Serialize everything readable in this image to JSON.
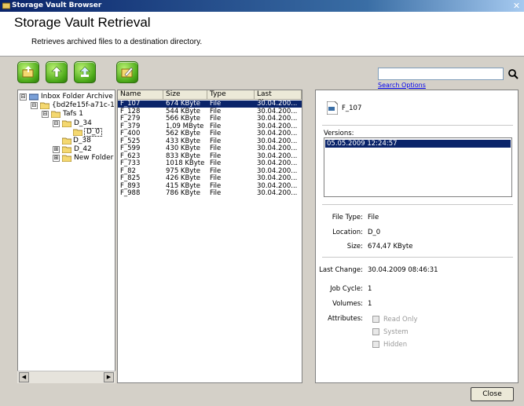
{
  "window": {
    "title": "Storage Vault Browser",
    "close_glyph": "✕"
  },
  "header": {
    "title": "Storage Vault Retrieval",
    "subtitle": "Retrieves archived files to a destination directory."
  },
  "toolbar": {
    "buttons": [
      "folder-restore-icon",
      "retrieve-icon",
      "retrieve-all-icon",
      "edit-icon"
    ],
    "accent": "#4aa818"
  },
  "search": {
    "value": "",
    "placeholder": "",
    "options_label": "Search Options"
  },
  "tree": {
    "nodes": [
      {
        "label": "Inbox Folder Archive",
        "expander": "⊟"
      },
      {
        "label": "{bd2fe15f-a71c-11d",
        "expander": "⊟"
      },
      {
        "label": "Tafs 1",
        "expander": "⊟"
      },
      {
        "label": "D_34",
        "expander": "⊟"
      },
      {
        "label": "D_0",
        "expander": ""
      },
      {
        "label": "D_38",
        "expander": ""
      },
      {
        "label": "D_42",
        "expander": "⊞"
      },
      {
        "label": "New Folder",
        "expander": "⊞"
      }
    ],
    "scroll_left": "◀",
    "scroll_right": "▶"
  },
  "filelist": {
    "columns": [
      "Name",
      "Size",
      "Type",
      "Last Change"
    ],
    "rows": [
      {
        "name": "F_107",
        "size": "674 KByte",
        "type": "File",
        "changed": "30.04.200..."
      },
      {
        "name": "F_128",
        "size": "544 KByte",
        "type": "File",
        "changed": "30.04.200..."
      },
      {
        "name": "F_279",
        "size": "566 KByte",
        "type": "File",
        "changed": "30.04.200..."
      },
      {
        "name": "F_379",
        "size": "1,09 MByte",
        "type": "File",
        "changed": "30.04.200..."
      },
      {
        "name": "F_400",
        "size": "562 KByte",
        "type": "File",
        "changed": "30.04.200..."
      },
      {
        "name": "F_525",
        "size": "433 KByte",
        "type": "File",
        "changed": "30.04.200..."
      },
      {
        "name": "F_599",
        "size": "430 KByte",
        "type": "File",
        "changed": "30.04.200..."
      },
      {
        "name": "F_623",
        "size": "833 KByte",
        "type": "File",
        "changed": "30.04.200..."
      },
      {
        "name": "F_733",
        "size": "1018 KByte",
        "type": "File",
        "changed": "30.04.200..."
      },
      {
        "name": "F_82",
        "size": "975 KByte",
        "type": "File",
        "changed": "30.04.200..."
      },
      {
        "name": "F_825",
        "size": "426 KByte",
        "type": "File",
        "changed": "30.04.200..."
      },
      {
        "name": "F_893",
        "size": "415 KByte",
        "type": "File",
        "changed": "30.04.200..."
      },
      {
        "name": "F_988",
        "size": "786 KByte",
        "type": "File",
        "changed": "30.04.200..."
      }
    ]
  },
  "details": {
    "file_name": "F_107",
    "versions_label": "Versions:",
    "versions": [
      "05.05.2009 12:24:57"
    ],
    "file_type_label": "File Type:",
    "file_type": "File",
    "location_label": "Location:",
    "location": "D_0",
    "size_label": "Size:",
    "size": "674,47 KByte",
    "last_change_label": "Last Change:",
    "last_change": "30.04.2009 08:46:31",
    "job_cycle_label": "Job Cycle:",
    "job_cycle": "1",
    "volumes_label": "Volumes:",
    "volumes": "1",
    "attributes_label": "Attributes:",
    "attributes": [
      "Read Only",
      "System",
      "Hidden"
    ]
  },
  "footer": {
    "close_label": "Close"
  }
}
